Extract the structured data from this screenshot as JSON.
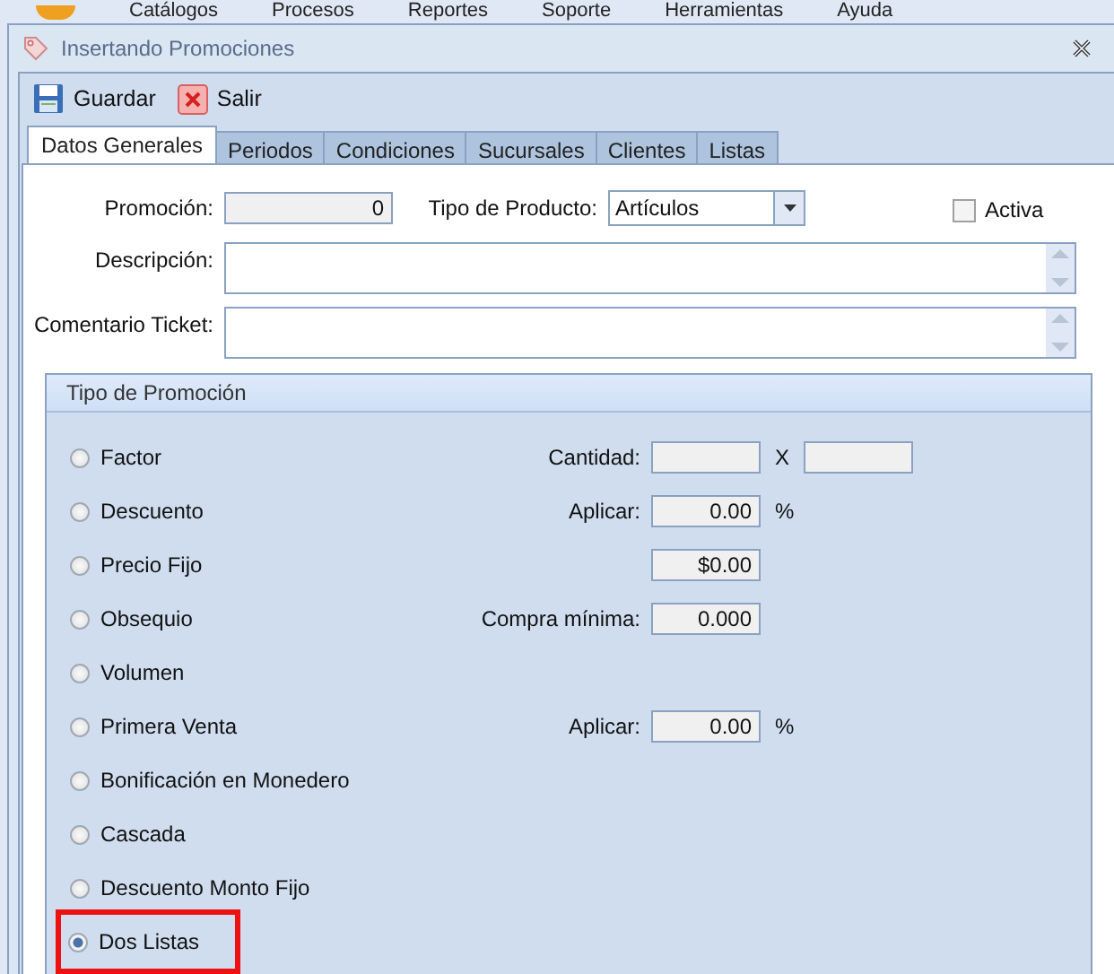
{
  "menu_bar": [
    "Catálogos",
    "Procesos",
    "Reportes",
    "Soporte",
    "Herramientas",
    "Ayuda"
  ],
  "window": {
    "title": "Insertando Promociones"
  },
  "toolbar": [
    {
      "kind": "save",
      "label": "Guardar"
    },
    {
      "kind": "exit",
      "label": "Salir"
    }
  ],
  "tabs": [
    {
      "label": "Datos Generales",
      "selected": true
    },
    {
      "label": "Periodos",
      "selected": false
    },
    {
      "label": "Condiciones",
      "selected": false
    },
    {
      "label": "Sucursales",
      "selected": false
    },
    {
      "label": "Clientes",
      "selected": false
    },
    {
      "label": "Listas",
      "selected": false
    }
  ],
  "form": {
    "promocion": {
      "label": "Promoción:",
      "value": "0"
    },
    "tipo_producto": {
      "label": "Tipo de Producto:",
      "value": "Artículos"
    },
    "activa": {
      "label": "Activa",
      "checked": false
    },
    "descripcion": {
      "label": "Descripción:"
    },
    "comentario": {
      "label": "Comentario Ticket:"
    }
  },
  "tipo_promocion": {
    "title": "Tipo de Promoción",
    "options": [
      {
        "label": "Factor",
        "selected": false,
        "highlighted": false
      },
      {
        "label": "Descuento",
        "selected": false,
        "highlighted": false
      },
      {
        "label": "Precio Fijo",
        "selected": false,
        "highlighted": false
      },
      {
        "label": "Obsequio",
        "selected": false,
        "highlighted": false
      },
      {
        "label": "Volumen",
        "selected": false,
        "highlighted": false
      },
      {
        "label": "Primera Venta",
        "selected": false,
        "highlighted": false
      },
      {
        "label": "Bonificación en Monedero",
        "selected": false,
        "highlighted": false
      },
      {
        "label": "Cascada",
        "selected": false,
        "highlighted": false
      },
      {
        "label": "Descuento Monto Fijo",
        "selected": false,
        "highlighted": false
      },
      {
        "label": "Dos Listas",
        "selected": true,
        "highlighted": true
      }
    ],
    "fields": [
      {
        "kind": "pair",
        "label": "Cantidad:",
        "separator": "X"
      },
      {
        "kind": "suffix",
        "label": "Aplicar:",
        "value": "0.00",
        "suffix": "%"
      },
      {
        "kind": "plain",
        "value": "$0.00"
      },
      {
        "kind": "plain",
        "label": "Compra mínima:",
        "value": "0.000"
      },
      {
        "kind": "spacer"
      },
      {
        "kind": "suffix",
        "label": "Aplicar:",
        "value": "0.00",
        "suffix": "%"
      }
    ]
  }
}
